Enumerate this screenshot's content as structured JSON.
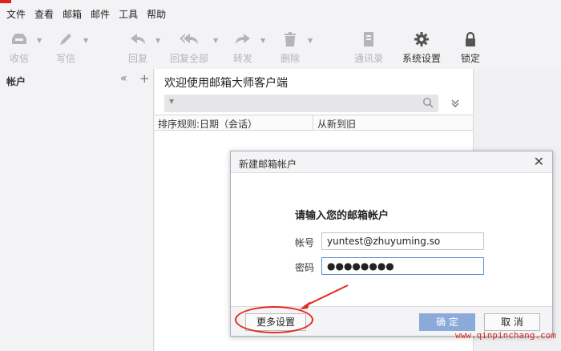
{
  "menu": [
    "文件",
    "查看",
    "邮箱",
    "邮件",
    "工具",
    "帮助"
  ],
  "toolbar": {
    "receive": "收信",
    "compose": "写信",
    "reply": "回复",
    "reply_all": "回复全部",
    "forward": "转发",
    "delete": "删除",
    "contacts": "通讯录",
    "settings": "系统设置",
    "lock": "锁定"
  },
  "sidebar": {
    "title": "帐户",
    "collapse_glyph": "«",
    "add_glyph": "+"
  },
  "main": {
    "welcome": "欢迎使用邮箱大师客户端",
    "sort_rule": "排序规则:日期（会话）",
    "sort_order": "从新到旧"
  },
  "dialog": {
    "title": "新建邮箱帐户",
    "close_glyph": "✕",
    "prompt": "请输入您的邮箱帐户",
    "account_label": "帐号",
    "account_value": "yuntest@zhuyuming.so",
    "password_label": "密码",
    "password_value": "●●●●●●●●",
    "more_settings": "更多设置",
    "ok": "确 定",
    "cancel": "取 消"
  },
  "watermark": "www.qinpinchang.com",
  "colors": {
    "accent_red": "#e42b1e",
    "ok_button": "#8ba9d9",
    "toolbar_disabled": "#b5b5b8",
    "toolbar_enabled": "#333333"
  },
  "icons": {
    "receive": "inbox-icon",
    "compose": "pen-icon",
    "reply": "reply-icon",
    "reply_all": "reply-all-icon",
    "forward": "forward-icon",
    "delete": "trash-icon",
    "contacts": "address-book-icon",
    "settings": "gear-icon",
    "lock": "lock-icon"
  }
}
